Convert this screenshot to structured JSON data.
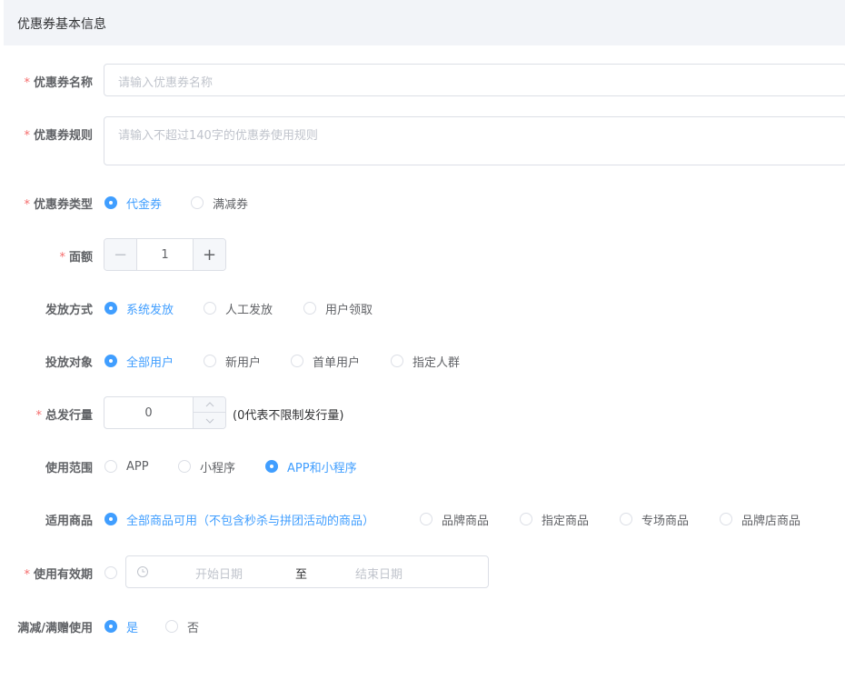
{
  "section": {
    "title": "优惠券基本信息"
  },
  "form": {
    "name": {
      "label": "优惠券名称",
      "required": "*",
      "placeholder": "请输入优惠券名称",
      "value": ""
    },
    "rules": {
      "label": "优惠券规则",
      "required": "*",
      "placeholder": "请输入不超过140字的优惠券使用规则",
      "value": ""
    },
    "type": {
      "label": "优惠券类型",
      "required": "*",
      "options": [
        {
          "label": "代金券",
          "checked": true
        },
        {
          "label": "满减券",
          "checked": false
        }
      ]
    },
    "amount": {
      "label": "面额",
      "required": "*",
      "value": "1",
      "minus": "−",
      "plus": "+"
    },
    "issue_method": {
      "label": "发放方式",
      "options": [
        {
          "label": "系统发放",
          "checked": true
        },
        {
          "label": "人工发放",
          "checked": false
        },
        {
          "label": "用户领取",
          "checked": false
        }
      ]
    },
    "target": {
      "label": "投放对象",
      "options": [
        {
          "label": "全部用户",
          "checked": true
        },
        {
          "label": "新用户",
          "checked": false
        },
        {
          "label": "首单用户",
          "checked": false
        },
        {
          "label": "指定人群",
          "checked": false
        }
      ]
    },
    "total": {
      "label": "总发行量",
      "required": "*",
      "value": "0",
      "note": "(0代表不限制发行量)"
    },
    "scope": {
      "label": "使用范围",
      "options": [
        {
          "label": "APP",
          "checked": false
        },
        {
          "label": "小程序",
          "checked": false
        },
        {
          "label": "APP和小程序",
          "checked": true
        }
      ]
    },
    "products": {
      "label": "适用商品",
      "options": [
        {
          "label": "全部商品可用（不包含秒杀与拼团活动的商品）",
          "checked": true
        },
        {
          "label": "品牌商品",
          "checked": false
        },
        {
          "label": "指定商品",
          "checked": false
        },
        {
          "label": "专场商品",
          "checked": false
        },
        {
          "label": "品牌店商品",
          "checked": false
        }
      ]
    },
    "validity": {
      "label": "使用有效期",
      "required": "*",
      "start_placeholder": "开始日期",
      "separator": "至",
      "end_placeholder": "结束日期"
    },
    "stack": {
      "label": "满减/满赠使用",
      "options": [
        {
          "label": "是",
          "checked": true
        },
        {
          "label": "否",
          "checked": false
        }
      ]
    }
  },
  "colors": {
    "primary": "#409eff",
    "required": "#f56c6c",
    "border": "#dcdfe6",
    "placeholder": "#c0c4cc",
    "header_bg": "#f2f4f8"
  }
}
